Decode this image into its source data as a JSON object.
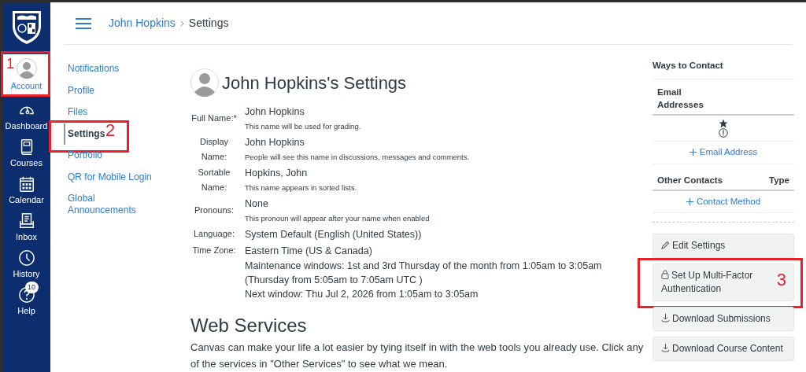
{
  "global_nav": {
    "items": [
      {
        "label": "Account",
        "kind": "avatar",
        "selected": true,
        "annotation": "1"
      },
      {
        "label": "Dashboard",
        "kind": "dashboard",
        "selected": false
      },
      {
        "label": "Courses",
        "kind": "courses",
        "selected": false
      },
      {
        "label": "Calendar",
        "kind": "calendar",
        "selected": false
      },
      {
        "label": "Inbox",
        "kind": "inbox",
        "selected": false
      },
      {
        "label": "History",
        "kind": "history",
        "selected": false
      },
      {
        "label": "Help",
        "kind": "help",
        "selected": false,
        "badge": "10"
      }
    ]
  },
  "breadcrumbs": [
    "John Hopkins",
    "Settings"
  ],
  "sub_nav": [
    {
      "label": "Notifications",
      "selected": false
    },
    {
      "label": "Profile",
      "selected": false
    },
    {
      "label": "Files",
      "selected": false
    },
    {
      "label": "Settings",
      "selected": true,
      "annotation": "2"
    },
    {
      "label": "Portfolio",
      "selected": false
    },
    {
      "label": "QR for Mobile Login",
      "selected": false
    },
    {
      "label": "Global Announcements",
      "selected": false
    }
  ],
  "page_title": "John Hopkins's Settings",
  "fields": [
    {
      "label": "Full Name:*",
      "value": "John Hopkins",
      "hint": "This name will be used for grading."
    },
    {
      "label": "Display Name:",
      "value": "John Hopkins",
      "hint": "People will see this name in discussions, messages and comments."
    },
    {
      "label": "Sortable Name:",
      "value": "Hopkins, John",
      "hint": "This name appears in sorted lists."
    },
    {
      "label": "Pronouns:",
      "value": "None",
      "hint": "This pronoun will appear after your name when enabled"
    },
    {
      "label": "Language:",
      "value": "System Default (English (United States))"
    },
    {
      "label": "Time Zone:",
      "value": "Eastern Time (US & Canada)"
    }
  ],
  "maintenance": [
    "Maintenance windows: 1st and 3rd Thursday of the month from 1:05am to 3:05am",
    "(Thursday from 5:05am to 7:05am UTC )",
    "Next window: Thu Jul 2, 2026 from 1:05am to 3:05am"
  ],
  "web_services": {
    "heading": "Web Services",
    "text": "Canvas can make your life a lot easier by tying itself in with the web tools you already use. Click any of the services in \"Other Services\" to see what we mean."
  },
  "ways_to_contact": {
    "title": "Ways to Contact",
    "email_header": "Email Addresses",
    "add_email": "Email Address",
    "other_header": "Other Contacts",
    "type_header": "Type",
    "add_contact": "Contact Method"
  },
  "actions": [
    {
      "label": "Edit Settings",
      "kind": "edit"
    },
    {
      "label": "Set Up Multi-Factor Authentication",
      "kind": "security",
      "annotation": "3"
    },
    {
      "label": "Download Submissions",
      "kind": "download"
    },
    {
      "label": "Download Course Content",
      "kind": "download"
    }
  ]
}
